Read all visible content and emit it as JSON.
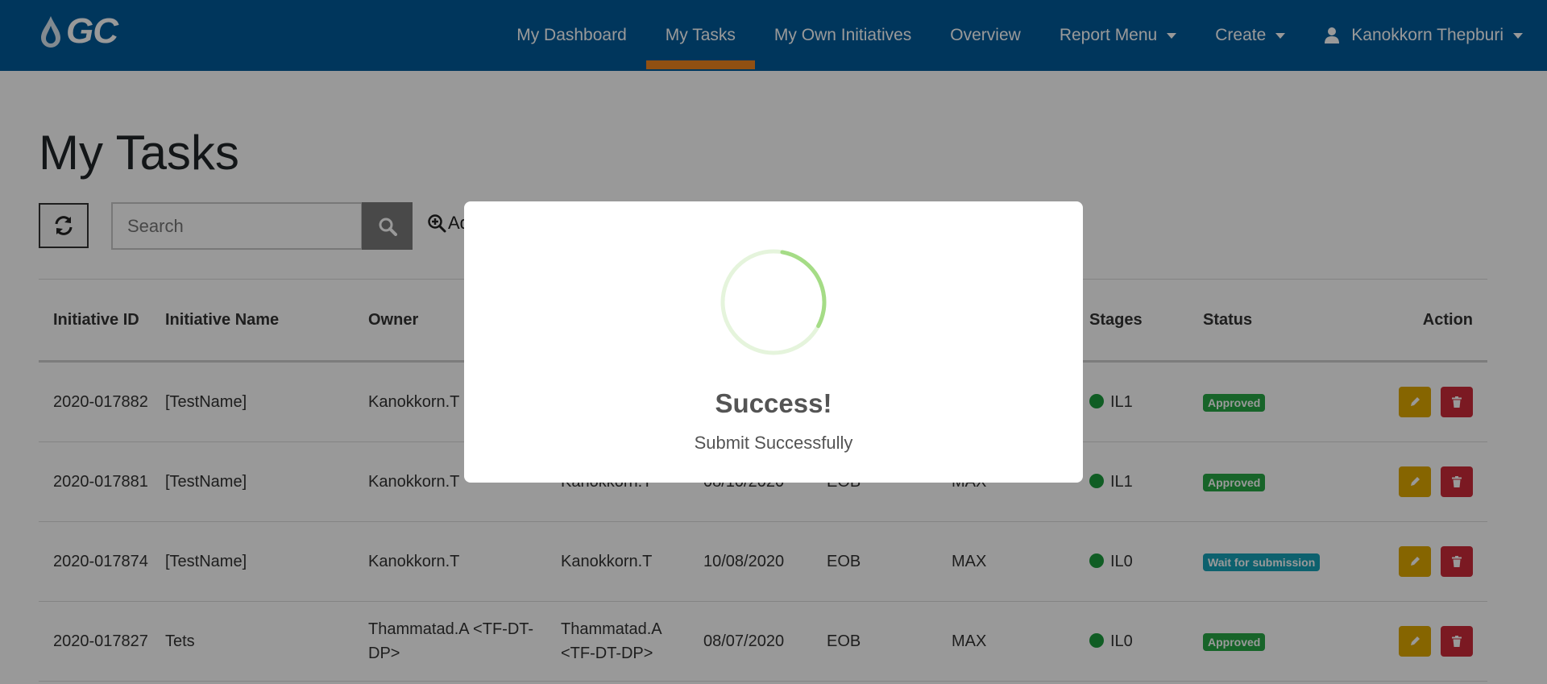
{
  "navbar": {
    "logo_text": "GC",
    "items": [
      {
        "label": "My Dashboard"
      },
      {
        "label": "My Tasks"
      },
      {
        "label": "My Own Initiatives"
      },
      {
        "label": "Overview"
      },
      {
        "label": "Report Menu"
      },
      {
        "label": "Create"
      }
    ],
    "user": "Kanokkorn Thepburi"
  },
  "page": {
    "title": "My Tasks",
    "search_placeholder": "Search",
    "advanced_label": "Ad"
  },
  "table": {
    "headers": [
      "Initiative ID",
      "Initiative Name",
      "Owner",
      "",
      "",
      "",
      "",
      "Stages",
      "Status",
      "Action"
    ],
    "rows": [
      {
        "id": "2020-017882",
        "name": "[TestName]",
        "owner": "Kanokkorn.T",
        "creator": "",
        "date": "",
        "type": "",
        "size": "",
        "stage": "IL1",
        "status": "Approved",
        "status_kind": "approved"
      },
      {
        "id": "2020-017881",
        "name": "[TestName]",
        "owner": "Kanokkorn.T",
        "creator": "Kanokkorn.T",
        "date": "08/10/2020",
        "type": "EOB",
        "size": "MAX",
        "stage": "IL1",
        "status": "Approved",
        "status_kind": "approved"
      },
      {
        "id": "2020-017874",
        "name": "[TestName]",
        "owner": "Kanokkorn.T",
        "creator": "Kanokkorn.T",
        "date": "10/08/2020",
        "type": "EOB",
        "size": "MAX",
        "stage": "IL0",
        "status": "Wait for submission",
        "status_kind": "wait"
      },
      {
        "id": "2020-017827",
        "name": "Tets",
        "owner": "Thammatad.A <TF-DT-DP>",
        "creator": "Thammatad.A <TF-DT-DP>",
        "date": "08/07/2020",
        "type": "EOB",
        "size": "MAX",
        "stage": "IL0",
        "status": "Approved",
        "status_kind": "approved"
      }
    ]
  },
  "modal": {
    "title": "Success!",
    "text": "Submit Successfully",
    "progress": 0.3
  },
  "colors": {
    "navbar": "#005b9a",
    "active_underline": "#f0851e",
    "approved": "#27a745",
    "wait": "#17a2b8",
    "edit": "#e0a800",
    "delete": "#cd2b3a",
    "spinner": "#a5dc86"
  },
  "icons": [
    "logo-drop-icon",
    "user-icon",
    "refresh-icon",
    "search-icon",
    "zoom-in-icon",
    "pencil-icon",
    "trash-icon"
  ]
}
